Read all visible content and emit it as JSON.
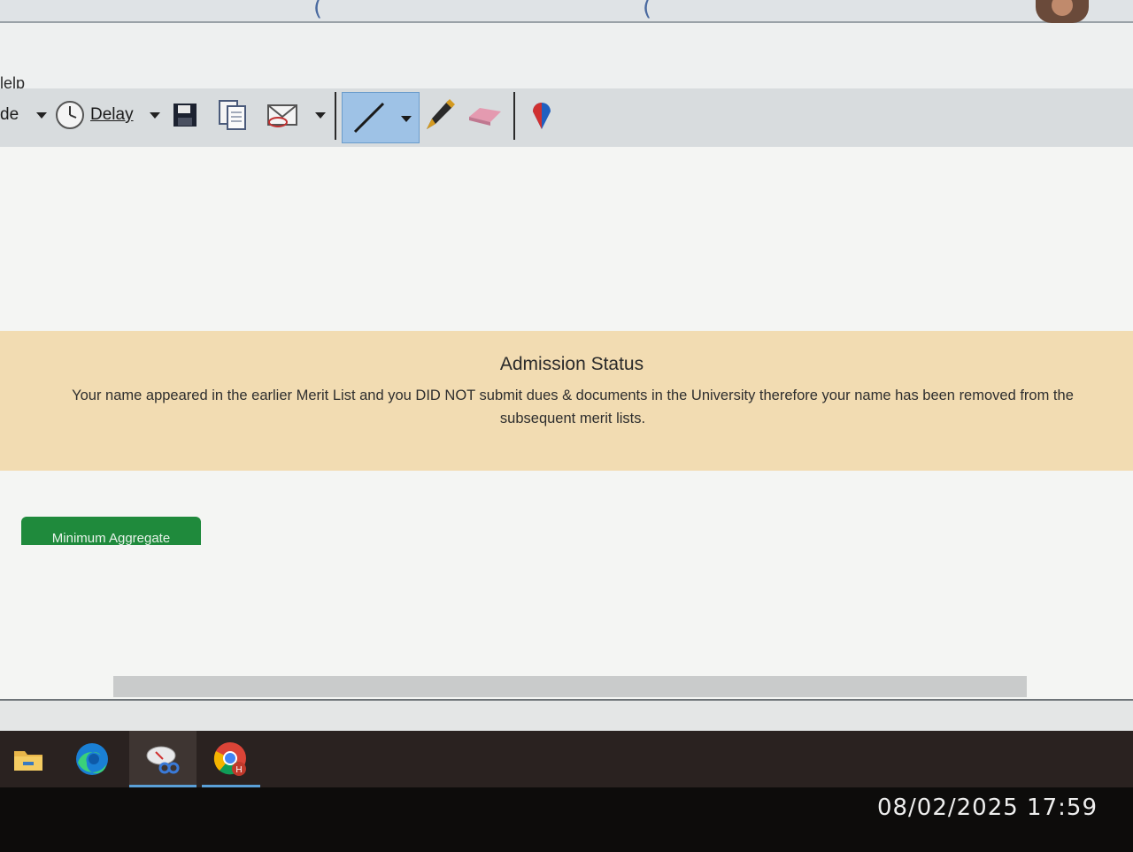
{
  "menu": {
    "help_label": "lelp"
  },
  "toolbar": {
    "mode_label": "de",
    "delay_label": "Delay"
  },
  "admission": {
    "title": "Admission Status",
    "message": "Your name appeared in the earlier Merit List and you DID NOT submit dues & documents in the University therefore your name has been removed from the subsequent merit lists."
  },
  "buttons": {
    "min_aggregate": "Minimum Aggregate"
  },
  "taskbar": {
    "apps": [
      "file-explorer-icon",
      "edge-icon",
      "snipping-tool-icon",
      "chrome-icon"
    ],
    "clock": "08/02/2025 17:59"
  },
  "colors": {
    "status_band": "#f2dcb2",
    "accent_green": "#1f8a3c",
    "pen_selected": "#9ec2e6"
  }
}
